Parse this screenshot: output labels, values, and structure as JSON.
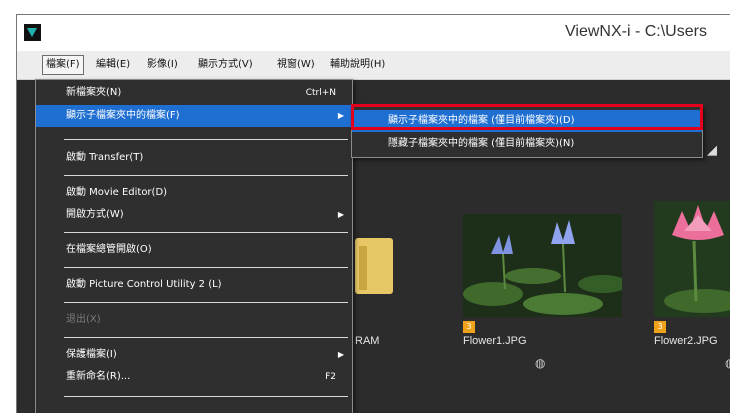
{
  "window": {
    "title": "ViewNX-i - C:\\Users"
  },
  "menubar": {
    "items": [
      {
        "label": "檔案(F)"
      },
      {
        "label": "編輯(E)"
      },
      {
        "label": "影像(I)"
      },
      {
        "label": "顯示方式(V)"
      },
      {
        "label": "視窗(W)"
      },
      {
        "label": "輔助說明(H)"
      }
    ]
  },
  "file_menu": {
    "new_folder": {
      "label": "新檔案夾(N)",
      "shortcut": "Ctrl+N"
    },
    "show_subfolder_files": {
      "label": "顯示子檔案夾中的檔案(F)"
    },
    "launch_transfer": {
      "label": "啟動 Transfer(T)"
    },
    "launch_movie_editor": {
      "label": "啟動 Movie Editor(D)"
    },
    "open_with": {
      "label": "開啟方式(W)"
    },
    "open_in_file_manager": {
      "label": "在檔案總管開啟(O)"
    },
    "launch_picture_control": {
      "label": "啟動 Picture Control Utility 2 (L)"
    },
    "exit": {
      "label": "退出(X)"
    },
    "protect_files": {
      "label": "保護檔案(I)"
    },
    "rename": {
      "label": "重新命名(R)...",
      "shortcut": "F2"
    }
  },
  "submenu": {
    "show_current_folder_only": "顯示子檔案夾中的檔案 (僅目前檔案夾)(D)",
    "hide_subfolder_files": "隱藏子檔案夾中的檔案 (僅目前檔案夾)(N)"
  },
  "browser": {
    "folder_caption": "RAM",
    "items": [
      {
        "name": "Flower1.JPG",
        "badge": "3"
      },
      {
        "name": "Flower2.JPG",
        "badge": "3"
      }
    ]
  },
  "colors": {
    "highlight": "#1f6fd3",
    "callout_border": "#e3001b",
    "badge": "#f0a21a"
  }
}
